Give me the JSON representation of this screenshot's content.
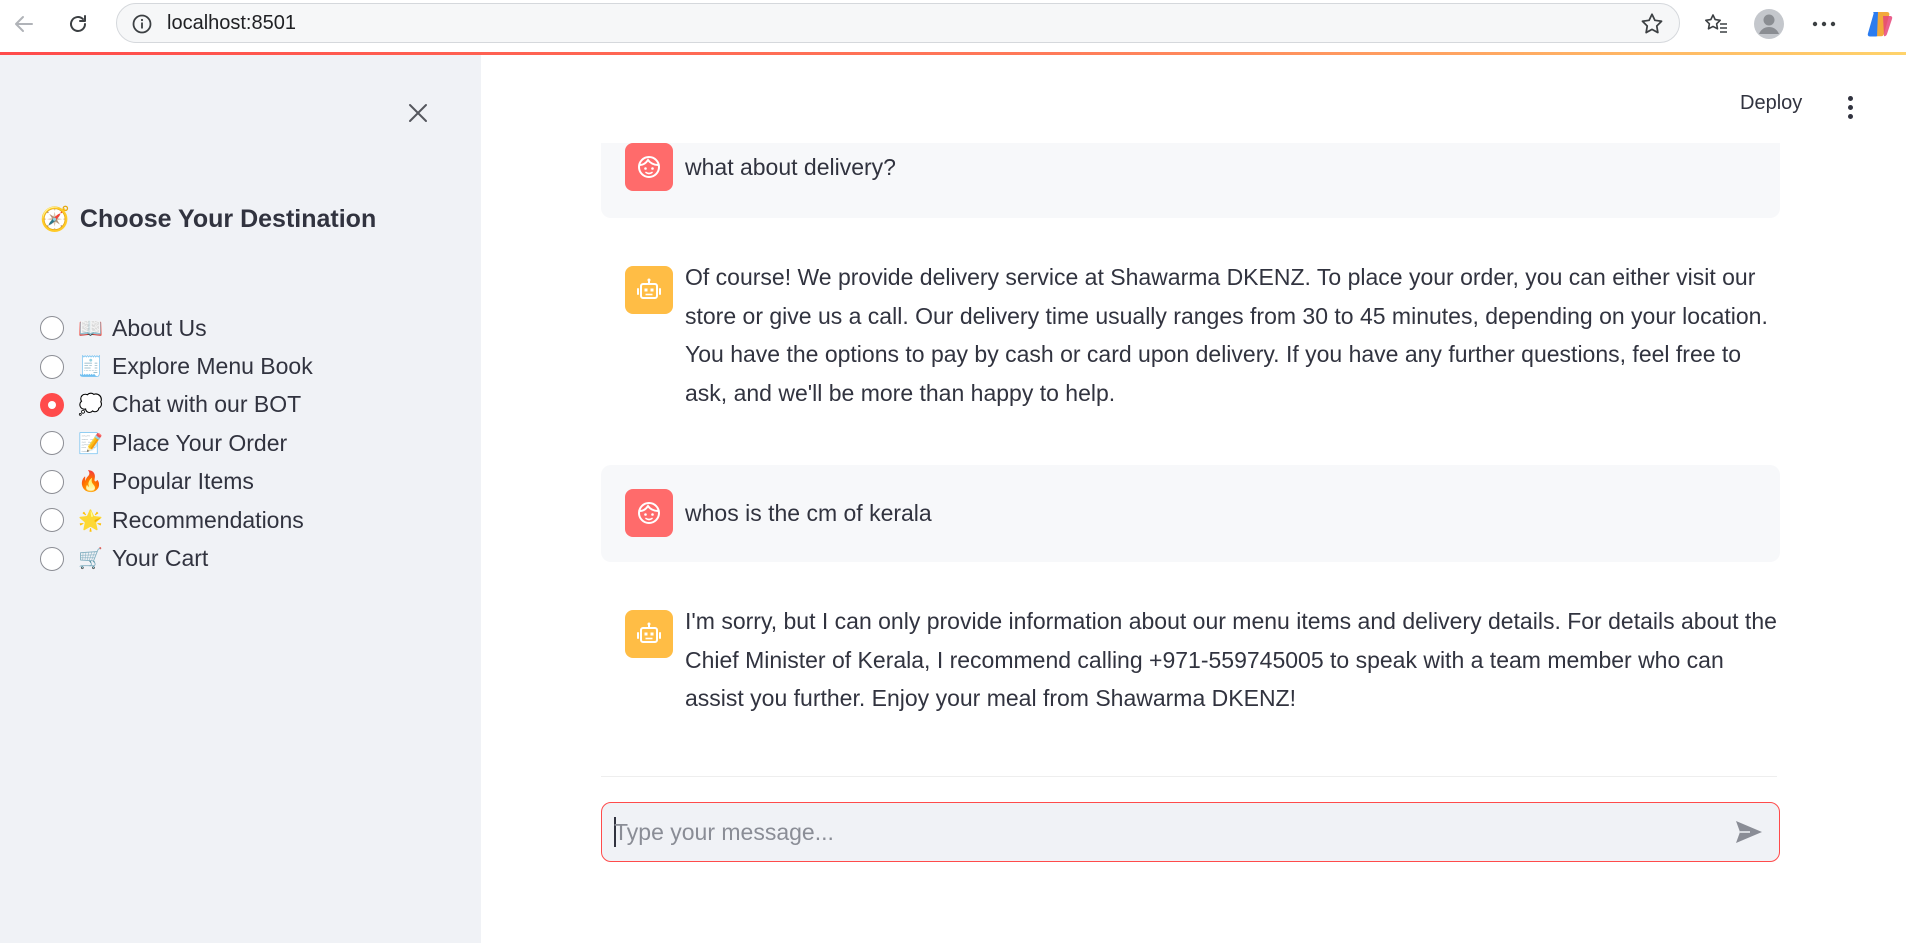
{
  "browser": {
    "url": "localhost:8501"
  },
  "sidebar": {
    "title_emoji": "🧭",
    "title": "Choose Your Destination",
    "items": [
      {
        "emoji": "📖",
        "label": "About Us",
        "checked": false
      },
      {
        "emoji": "🧾",
        "label": "Explore Menu Book",
        "checked": false
      },
      {
        "emoji": "💭",
        "label": "Chat with our BOT",
        "checked": true
      },
      {
        "emoji": "📝",
        "label": "Place Your Order",
        "checked": false
      },
      {
        "emoji": "🔥",
        "label": "Popular Items",
        "checked": false
      },
      {
        "emoji": "🌟",
        "label": "Recommendations",
        "checked": false
      },
      {
        "emoji": "🛒",
        "label": "Your Cart",
        "checked": false
      }
    ]
  },
  "header": {
    "deploy_label": "Deploy"
  },
  "chat": {
    "messages": [
      {
        "role": "user",
        "text": "what about delivery?"
      },
      {
        "role": "assistant",
        "text": "Of course! We provide delivery service at Shawarma DKENZ. To place your order, you can either visit our store or give us a call. Our delivery time usually ranges from 30 to 45 minutes, depending on your location. You have the options to pay by cash or card upon delivery. If you have any further questions, feel free to ask, and we'll be more than happy to help."
      },
      {
        "role": "user",
        "text": "whos is the cm of kerala"
      },
      {
        "role": "assistant",
        "text": "I'm sorry, but I can only provide information about our menu items and delivery details. For details about the Chief Minister of Kerala, I recommend calling +971-559745005 to speak with a team member who can assist you further. Enjoy your meal from Shawarma DKENZ!"
      }
    ],
    "input_placeholder": "Type your message..."
  },
  "colors": {
    "accent": "#ff4b4b",
    "user_avatar": "#ff6b6b",
    "bot_avatar": "#ffbd45",
    "sidebar_bg": "#f0f2f6"
  }
}
